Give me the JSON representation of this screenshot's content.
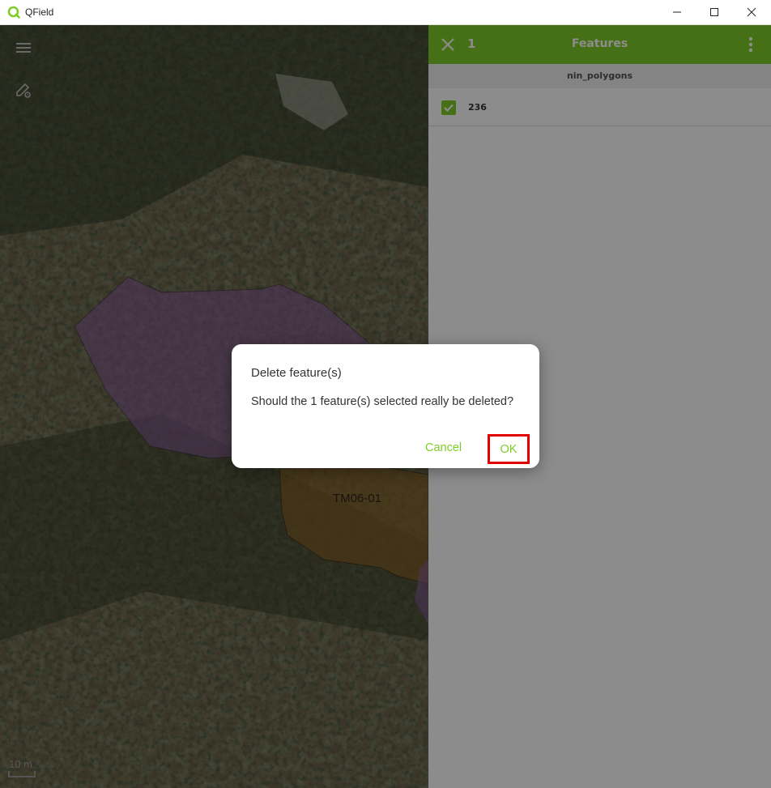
{
  "window": {
    "title": "QField",
    "minimize_icon": "minimize-icon",
    "maximize_icon": "maximize-icon",
    "close_icon": "close-icon"
  },
  "map": {
    "menu_icon": "hamburger-menu-icon",
    "digitize_icon": "pencil-settings-icon",
    "polygon_label": "TM06-01",
    "scale_label": "10 m"
  },
  "features_panel": {
    "count": "1",
    "title": "Features",
    "layer_name": "nin_polygons",
    "items": [
      {
        "name": "236",
        "checked": true
      }
    ],
    "accent_color": "#80cc28"
  },
  "dialog": {
    "title": "Delete feature(s)",
    "message": "Should the 1 feature(s) selected really be deleted?",
    "cancel_label": "Cancel",
    "ok_label": "OK",
    "highlight_color": "#e20000"
  }
}
